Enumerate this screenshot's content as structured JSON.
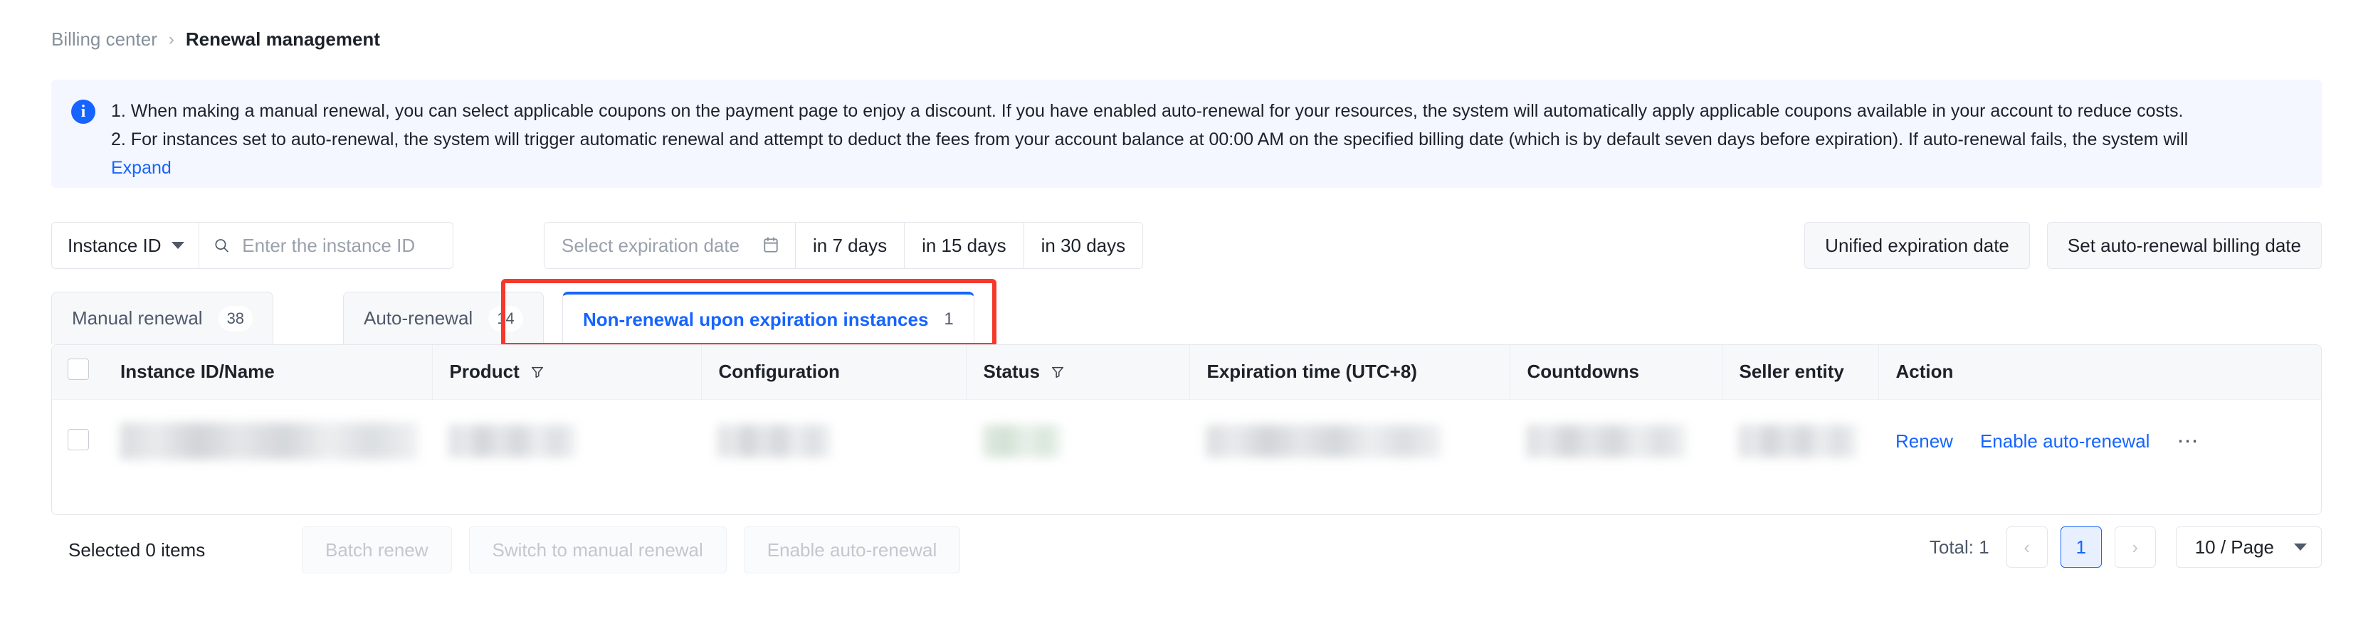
{
  "breadcrumb": {
    "parent": "Billing center",
    "separator": "›",
    "current": "Renewal management"
  },
  "banner": {
    "icon": "info-icon",
    "line1": "1. When making a manual renewal, you can select applicable coupons on the payment page to enjoy a discount. If you have enabled auto-renewal for your resources, the system will automatically apply applicable coupons available in your account to reduce costs.",
    "line2": "2. For instances set to auto-renewal, the system will trigger automatic renewal and attempt to deduct the fees from your account balance at 00:00 AM on the specified billing date (which is by default seven days before expiration). If auto-renewal fails, the system will",
    "expand_label": "Expand",
    "accent": "#1664FF",
    "background": "#F4F7FF"
  },
  "filters": {
    "search_scope_label": "Instance ID",
    "search_placeholder": "Enter the instance ID",
    "search_value": "",
    "date_placeholder": "Select expiration date",
    "quick_ranges": [
      "in 7 days",
      "in 15 days",
      "in 30 days"
    ],
    "unified_expiration_label": "Unified expiration date",
    "set_billing_date_label": "Set auto-renewal billing date"
  },
  "tabs": [
    {
      "label": "Manual renewal",
      "count": "38",
      "active": false
    },
    {
      "label": "Auto-renewal",
      "count": "14",
      "active": false
    },
    {
      "label": "Non-renewal upon expiration instances",
      "count": "1",
      "active": true
    }
  ],
  "highlight": {
    "color": "#F5392C"
  },
  "table": {
    "columns": [
      {
        "label": "Instance ID/Name",
        "filter": false
      },
      {
        "label": "Product",
        "filter": true
      },
      {
        "label": "Configuration",
        "filter": false
      },
      {
        "label": "Status",
        "filter": true
      },
      {
        "label": "Expiration time (UTC+8)",
        "filter": false
      },
      {
        "label": "Countdowns",
        "filter": false
      },
      {
        "label": "Seller entity",
        "filter": false
      },
      {
        "label": "Action",
        "filter": false
      }
    ],
    "rows": [
      {
        "redacted": true,
        "actions": {
          "renew": "Renew",
          "enable_auto_renewal": "Enable auto-renewal",
          "more": "⋯"
        }
      }
    ]
  },
  "footer": {
    "selected_text": "Selected 0 items",
    "batch_renew_label": "Batch renew",
    "switch_manual_label": "Switch to manual renewal",
    "enable_auto_label": "Enable auto-renewal",
    "total_label": "Total: 1",
    "prev_label": "‹",
    "page_number": "1",
    "next_label": "›",
    "page_size_label": "10  / Page"
  }
}
